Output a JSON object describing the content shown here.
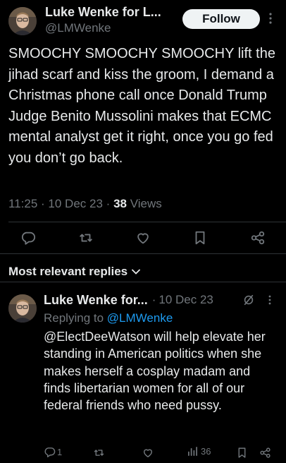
{
  "post": {
    "author_name": "Luke Wenke for L...",
    "author_handle": "@LMWenke",
    "follow_label": "Follow",
    "text": "SMOOCHY SMOOCHY SMOOCHY lift the jihad scarf and kiss the groom, I demand a Christmas phone call once Donald Trump Judge Benito Mussolini makes that ECMC mental analyst get it right, once you go fed you don’t go back.",
    "time": "11:25",
    "sep1": "·",
    "date": "10 Dec 23",
    "sep2": "·",
    "views_count": "38",
    "views_label": "Views"
  },
  "replies_section": {
    "sort_label": "Most relevant replies"
  },
  "reply": {
    "author_name": "Luke Wenke for...",
    "sep": "·",
    "date": "10 Dec 23",
    "replying_to_label": "Replying to",
    "replying_to_handle": "@LMWenke",
    "text_mention": "@ElectDeeWatson",
    "text_rest": " will help elevate her standing in American politics when she makes herself a cosplay madam and finds libertarian women for all of our federal friends who need pussy.",
    "reply_count": "1",
    "views_count": "36"
  },
  "colors": {
    "background": "#000000",
    "text": "#e7e9ea",
    "muted": "#71767b",
    "accent": "#1d9bf0",
    "divider": "#2f3336"
  },
  "icons": [
    "more-icon",
    "reply-icon",
    "retweet-icon",
    "like-icon",
    "bookmark-icon",
    "share-icon",
    "chevron-down-icon",
    "grok-icon",
    "views-icon"
  ]
}
